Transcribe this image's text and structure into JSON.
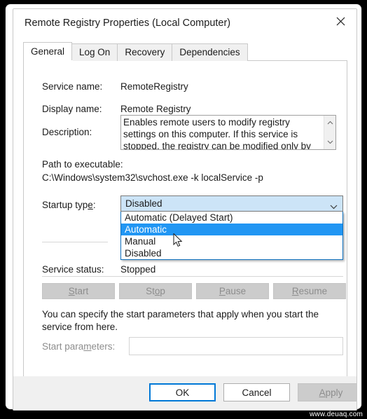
{
  "window": {
    "title": "Remote Registry Properties (Local Computer)",
    "close_icon": "close-icon"
  },
  "tabs": [
    {
      "label": "General",
      "active": true
    },
    {
      "label": "Log On",
      "active": false
    },
    {
      "label": "Recovery",
      "active": false
    },
    {
      "label": "Dependencies",
      "active": false
    }
  ],
  "general": {
    "service_name_label": "Service name:",
    "service_name_value": "RemoteRegistry",
    "display_name_label": "Display name:",
    "display_name_value": "Remote Registry",
    "description_label": "Description:",
    "description_value": "Enables remote users to modify registry settings on this computer. If this service is stopped, the registry can be modified only by users on this computer. If",
    "path_label": "Path to executable:",
    "path_value": "C:\\Windows\\system32\\svchost.exe -k localService -p",
    "startup_type_label": "Startup type:",
    "startup_type_value": "Disabled",
    "startup_type_options": [
      "Automatic (Delayed Start)",
      "Automatic",
      "Manual",
      "Disabled"
    ],
    "startup_type_highlighted": "Automatic",
    "dropdown_open": true,
    "service_status_label": "Service status:",
    "service_status_value": "Stopped",
    "actions": [
      {
        "name": "start-button",
        "prefix": "S",
        "rest": "tart",
        "enabled": false
      },
      {
        "name": "stop-button",
        "prefix": "St",
        "rest": "op",
        "enabled": false,
        "acc_index": 2
      },
      {
        "name": "pause-button",
        "prefix": "P",
        "rest": "ause",
        "enabled": false
      },
      {
        "name": "resume-button",
        "prefix": "R",
        "rest": "esume",
        "enabled": false
      }
    ],
    "action_labels": {
      "start": "Start",
      "stop": "Stop",
      "pause": "Pause",
      "resume": "Resume"
    },
    "help_text": "You can specify the start parameters that apply when you start the service from here.",
    "start_parameters_label": "Start parameters:",
    "start_parameters_value": "",
    "start_parameters_enabled": false
  },
  "footer": {
    "ok_label": "OK",
    "cancel_label": "Cancel",
    "apply_label": "Apply",
    "apply_enabled": false
  },
  "watermark": "www.deuaq.com",
  "colors": {
    "accent": "#0078d7",
    "selection": "#2196f3",
    "combo_background": "#cce4f7",
    "disabled_text": "#8d8d8d",
    "dialog_background": "#ffffff",
    "bar_background": "#f0f0f0"
  }
}
